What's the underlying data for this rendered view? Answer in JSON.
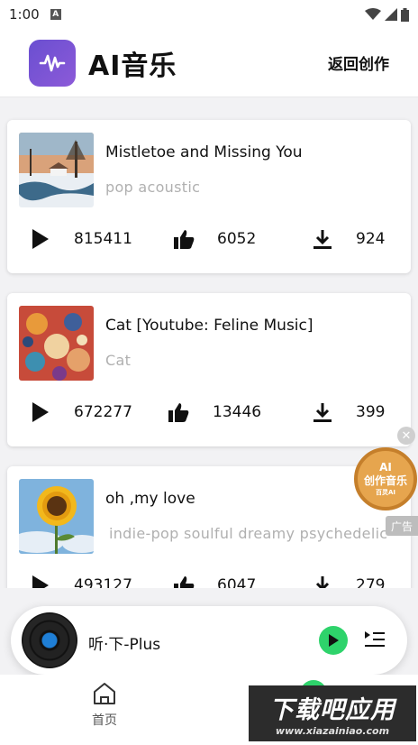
{
  "status_bar": {
    "time": "1:00",
    "notif_letter": "A"
  },
  "header": {
    "app_title": "AI音乐",
    "back_label": "返回创作"
  },
  "songs": [
    {
      "title": "Mistletoe and Missing You",
      "tags": "pop acoustic",
      "plays": "815411",
      "likes": "6052",
      "downloads": "924"
    },
    {
      "title": "Cat [Youtube: Feline Music]",
      "tags": "Cat",
      "plays": "672277",
      "likes": "13446",
      "downloads": "399"
    },
    {
      "title": "oh ,my love",
      "tags": "indie-pop soulful  dreamy psychedelic",
      "plays": "493127",
      "likes": "6047",
      "downloads": "279"
    }
  ],
  "ad": {
    "line1": "AI",
    "line2": "创作音乐",
    "line3": "百灵AI",
    "label": "广告",
    "close": "✕"
  },
  "player": {
    "title": "听·下-Plus"
  },
  "bottom_nav": {
    "home_label": "首页"
  },
  "watermark": {
    "main": "下载吧应用",
    "sub": "www.xiazainiao.com"
  },
  "colors": {
    "accent_green": "#2ed36b",
    "logo_purple": "#6a4fd1",
    "tag_gray": "#b0b0b0"
  }
}
